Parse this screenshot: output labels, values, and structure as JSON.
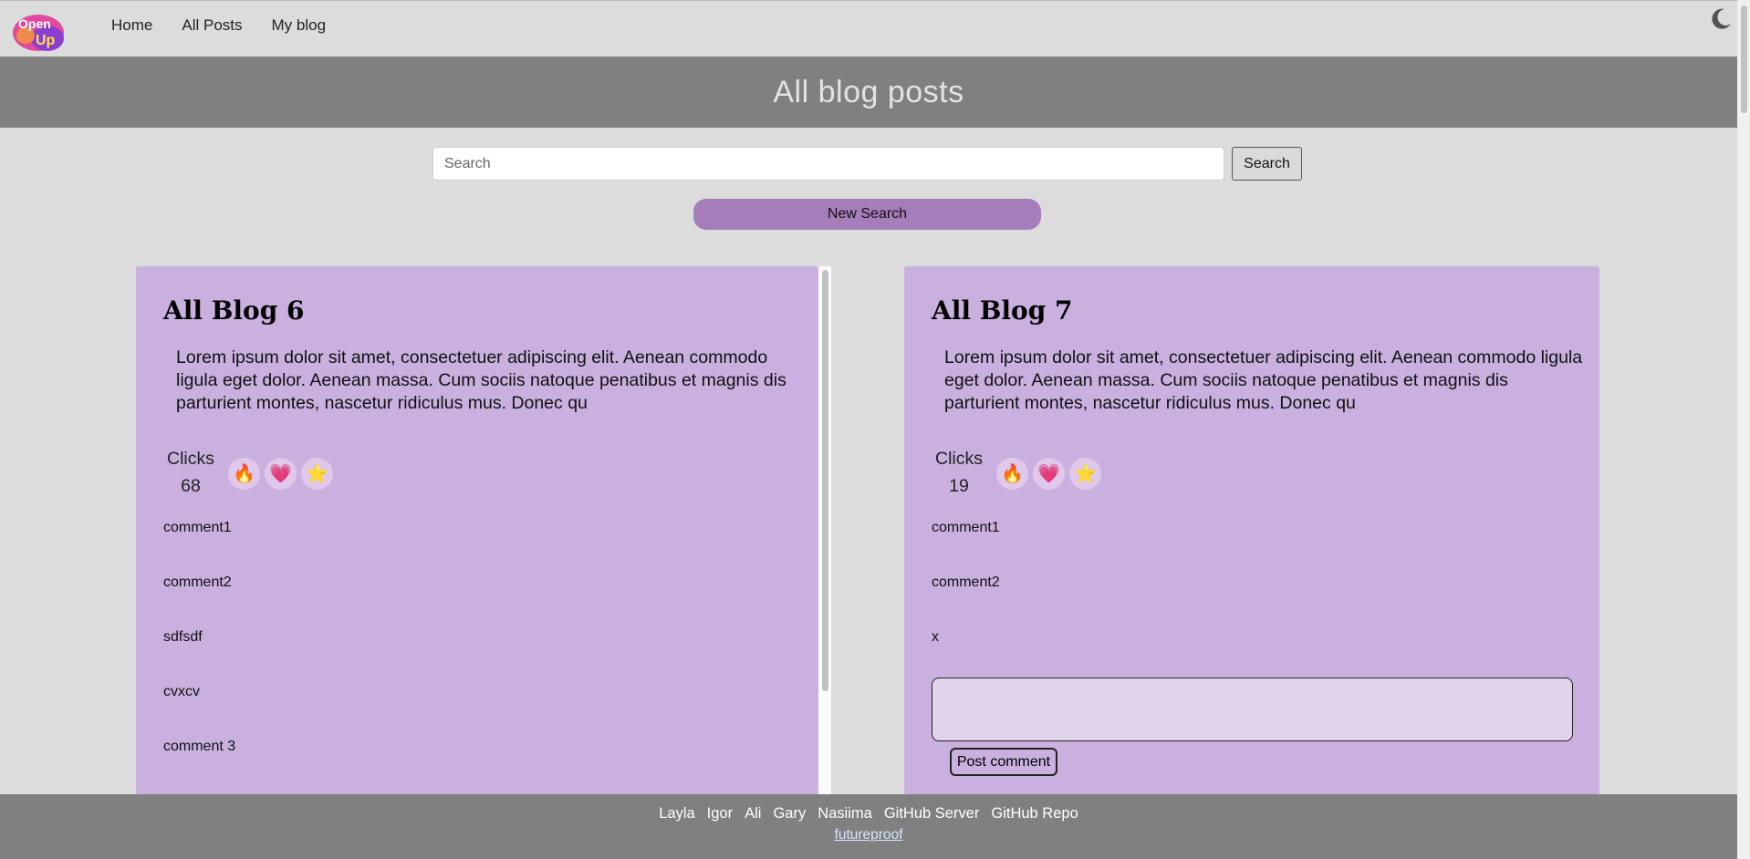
{
  "nav": {
    "logo_text": "Open Up",
    "links": [
      "Home",
      "All Posts",
      "My blog"
    ]
  },
  "header": {
    "title": "All blog posts"
  },
  "search": {
    "placeholder": "Search",
    "button": "Search",
    "new_search": "New Search"
  },
  "posts": [
    {
      "title": "All Blog 6",
      "body": "Lorem ipsum dolor sit amet, consectetuer adipiscing elit. Aenean commodo ligula eget dolor. Aenean massa. Cum sociis natoque penatibus et magnis dis parturient montes, nascetur ridiculus mus. Donec qu",
      "clicks_label": "Clicks",
      "clicks": "68",
      "reactions": [
        "🔥",
        "💗",
        "⭐"
      ],
      "comments": [
        "comment1",
        "comment2",
        "sdfsdf",
        "cvxcv",
        "comment 3"
      ]
    },
    {
      "title": "All Blog 7",
      "body": "Lorem ipsum dolor sit amet, consectetuer adipiscing elit. Aenean commodo ligula eget dolor. Aenean massa. Cum sociis natoque penatibus et magnis dis parturient montes, nascetur ridiculus mus. Donec qu",
      "clicks_label": "Clicks",
      "clicks": "19",
      "reactions": [
        "🔥",
        "💗",
        "⭐"
      ],
      "comments": [
        "comment1",
        "comment2",
        "x"
      ],
      "post_comment_label": "Post comment"
    }
  ],
  "footer": {
    "links": [
      "Layla",
      "Igor",
      "Ali",
      "Gary",
      "Nasiima",
      "GitHub Server",
      "GitHub Repo"
    ],
    "brand": "futureproof"
  },
  "colors": {
    "background": "#dcdcdc",
    "header_band": "#808080",
    "card": "#c9b0df",
    "accent_button": "#a57dbb"
  },
  "icons": {
    "logo": "open-up-logo",
    "theme": "moon-icon"
  }
}
